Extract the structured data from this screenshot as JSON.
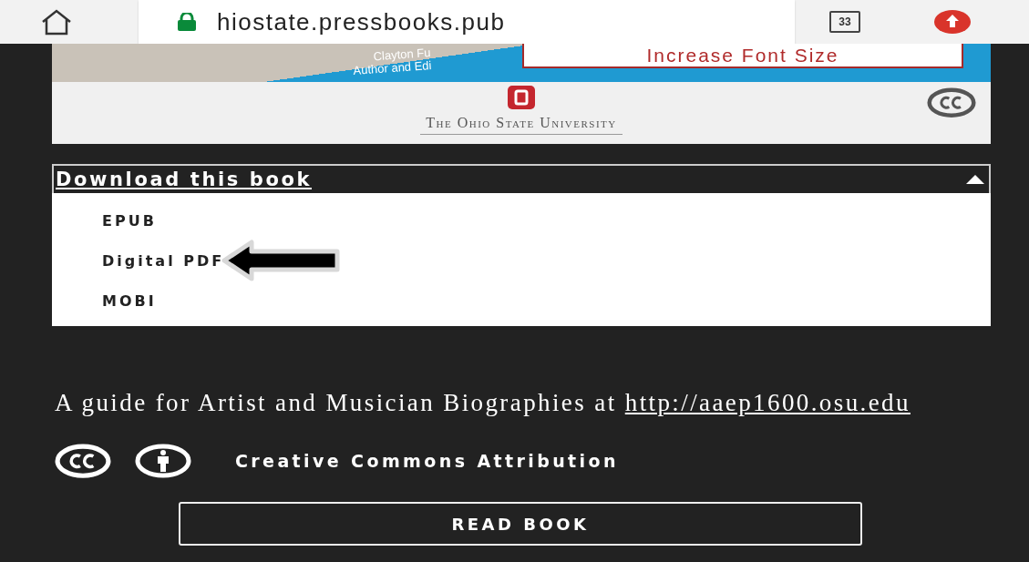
{
  "browser": {
    "url": "hiostate.pressbooks.pub",
    "tab_count": "33"
  },
  "cover": {
    "banner_lines": [
      "Clayton Fu",
      "Author and Edi"
    ],
    "font_button": "Increase Font Size",
    "institution": "The Ohio State University"
  },
  "download": {
    "label": "Download this book",
    "expanded": true,
    "formats": [
      {
        "label": "EPUB",
        "pointed": false
      },
      {
        "label": "Digital PDF",
        "pointed": true
      },
      {
        "label": "MOBI",
        "pointed": false
      }
    ]
  },
  "about": {
    "text": "A guide for Artist and Musician Biographies at ",
    "link": "http://aaep1600.osu.edu"
  },
  "license": {
    "label": "Creative Commons Attribution"
  },
  "read_button": "READ BOOK"
}
